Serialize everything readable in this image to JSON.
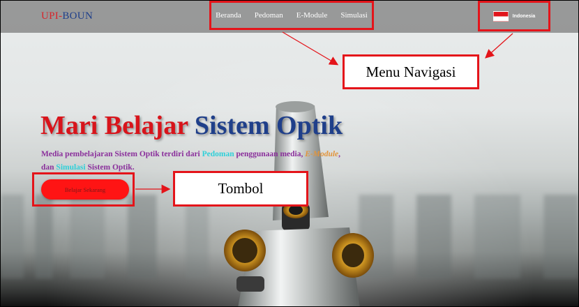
{
  "navbar": {
    "brand_part1": "UPI-",
    "brand_part2": "BOUN",
    "menu": [
      "Beranda",
      "Pedoman",
      "E-Module",
      "Simulasi"
    ],
    "language": "Indonesia"
  },
  "hero": {
    "title_part1": "Mari Belajar",
    "title_part2": "Sistem Optik",
    "desc_1": "Media pembelajaran Sistem Optik terdiri dari",
    "desc_link_pedoman": "Pedoman",
    "desc_2": "penggunaan media,",
    "desc_link_emodule": "E-Module",
    "desc_3": ",",
    "desc_4": "dan",
    "desc_link_simulasi": "Simulasi",
    "desc_5": "Sistem Optik.",
    "cta_label": "Belajar Sekarang"
  },
  "annotations": {
    "menu_label": "Menu Navigasi",
    "button_label": "Tombol"
  },
  "colors": {
    "brand_red": "#d8141b",
    "brand_blue": "#1f3f8a",
    "highlight_red": "#e4141a",
    "desc_purple": "#8a2f9b",
    "link_cyan": "#2fd0d9",
    "link_orange": "#e2953c"
  },
  "icons": {
    "flag": "indonesia-flag-icon"
  }
}
